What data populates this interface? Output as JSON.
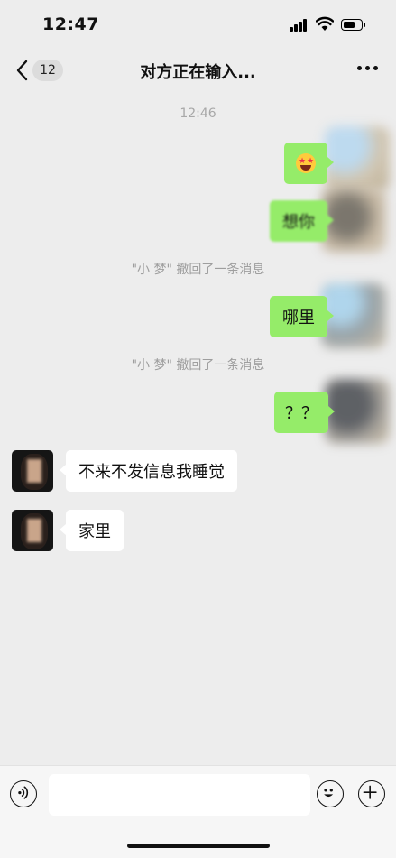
{
  "status_bar": {
    "time": "12:47"
  },
  "nav": {
    "unread_count": "12",
    "title": "对方正在输入..."
  },
  "chat": {
    "timestamp": "12:46",
    "messages": [
      {
        "side": "out",
        "emoji": "star-struck-emoji"
      },
      {
        "side": "out",
        "text": "想你"
      },
      {
        "system": "\"小  梦\" 撤回了一条消息"
      },
      {
        "side": "out",
        "text": "哪里"
      },
      {
        "system": "\"小  梦\" 撤回了一条消息"
      },
      {
        "side": "out",
        "text": "？？"
      },
      {
        "side": "in",
        "text": "不来不发信息我睡觉"
      },
      {
        "side": "in",
        "text": "家里"
      }
    ]
  },
  "input_bar": {
    "placeholder": ""
  },
  "colors": {
    "outgoing_bubble": "#95ec69",
    "incoming_bubble": "#ffffff",
    "background": "#ededed"
  }
}
